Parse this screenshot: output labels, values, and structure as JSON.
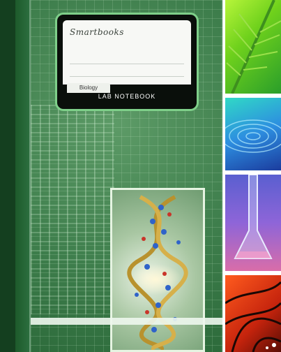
{
  "cover": {
    "brand": "Smartbooks",
    "brand_tagline": "",
    "tab_label": "Biology",
    "title": "LAB NOTEBOOK"
  },
  "panels": [
    {
      "name": "leaf-veins",
      "color": "#6fd11c"
    },
    {
      "name": "water-ripples",
      "color": "#2d8ee0"
    },
    {
      "name": "lab-flask",
      "color": "#8e65d8"
    },
    {
      "name": "butterfly-wing",
      "color": "#ff5b1e"
    }
  ],
  "colors": {
    "cover_green": "#3f7f4d",
    "spine": "#143f1f",
    "label_glow": "#7fd08a"
  }
}
